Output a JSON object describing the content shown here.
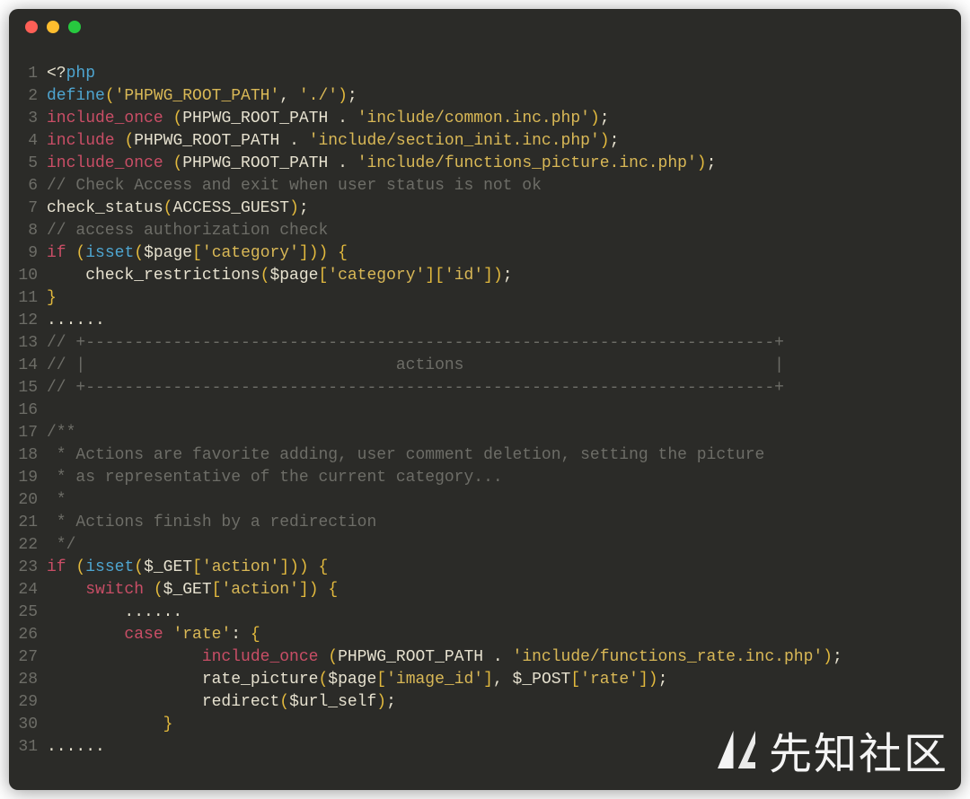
{
  "window": {
    "traffic_lights": [
      "close",
      "minimize",
      "zoom"
    ]
  },
  "watermark": {
    "text": "先知社区",
    "logo_name": "xianzhi-logo"
  },
  "code": {
    "language": "php",
    "lines": [
      {
        "n": 1,
        "tokens": [
          [
            "c-default",
            "<?"
          ],
          [
            "c-blue",
            "php"
          ]
        ]
      },
      {
        "n": 2,
        "tokens": [
          [
            "c-blue",
            "define"
          ],
          [
            "c-paren",
            "("
          ],
          [
            "c-string",
            "'PHPWG_ROOT_PATH'"
          ],
          [
            "c-default",
            ", "
          ],
          [
            "c-string",
            "'./'"
          ],
          [
            "c-paren",
            ")"
          ],
          [
            "c-default",
            ";"
          ]
        ]
      },
      {
        "n": 3,
        "tokens": [
          [
            "c-keyword",
            "include_once"
          ],
          [
            "c-default",
            " "
          ],
          [
            "c-paren",
            "("
          ],
          [
            "c-default",
            "PHPWG_ROOT_PATH . "
          ],
          [
            "c-string",
            "'include/common.inc.php'"
          ],
          [
            "c-paren",
            ")"
          ],
          [
            "c-default",
            ";"
          ]
        ]
      },
      {
        "n": 4,
        "tokens": [
          [
            "c-keyword",
            "include"
          ],
          [
            "c-default",
            " "
          ],
          [
            "c-paren",
            "("
          ],
          [
            "c-default",
            "PHPWG_ROOT_PATH . "
          ],
          [
            "c-string",
            "'include/section_init.inc.php'"
          ],
          [
            "c-paren",
            ")"
          ],
          [
            "c-default",
            ";"
          ]
        ]
      },
      {
        "n": 5,
        "tokens": [
          [
            "c-keyword",
            "include_once"
          ],
          [
            "c-default",
            " "
          ],
          [
            "c-paren",
            "("
          ],
          [
            "c-default",
            "PHPWG_ROOT_PATH . "
          ],
          [
            "c-string",
            "'include/functions_picture.inc.php'"
          ],
          [
            "c-paren",
            ")"
          ],
          [
            "c-default",
            ";"
          ]
        ]
      },
      {
        "n": 6,
        "tokens": [
          [
            "c-comment",
            "// Check Access and exit when user status is not ok"
          ]
        ]
      },
      {
        "n": 7,
        "tokens": [
          [
            "c-default",
            "check_status"
          ],
          [
            "c-paren",
            "("
          ],
          [
            "c-default",
            "ACCESS_GUEST"
          ],
          [
            "c-paren",
            ")"
          ],
          [
            "c-default",
            ";"
          ]
        ]
      },
      {
        "n": 8,
        "tokens": [
          [
            "c-comment",
            "// access authorization check"
          ]
        ]
      },
      {
        "n": 9,
        "tokens": [
          [
            "c-keyword",
            "if"
          ],
          [
            "c-default",
            " "
          ],
          [
            "c-paren",
            "("
          ],
          [
            "c-blue",
            "isset"
          ],
          [
            "c-paren",
            "("
          ],
          [
            "c-default",
            "$page"
          ],
          [
            "c-paren",
            "["
          ],
          [
            "c-string",
            "'category'"
          ],
          [
            "c-paren",
            "]))"
          ],
          [
            "c-default",
            " "
          ],
          [
            "c-brace",
            "{"
          ]
        ]
      },
      {
        "n": 10,
        "tokens": [
          [
            "c-default",
            "    check_restrictions"
          ],
          [
            "c-paren",
            "("
          ],
          [
            "c-default",
            "$page"
          ],
          [
            "c-paren",
            "["
          ],
          [
            "c-string",
            "'category'"
          ],
          [
            "c-paren",
            "]["
          ],
          [
            "c-string",
            "'id'"
          ],
          [
            "c-paren",
            "])"
          ],
          [
            "c-default",
            ";"
          ]
        ]
      },
      {
        "n": 11,
        "tokens": [
          [
            "c-brace",
            "}"
          ]
        ]
      },
      {
        "n": 12,
        "tokens": [
          [
            "c-default",
            "......"
          ]
        ]
      },
      {
        "n": 13,
        "tokens": [
          [
            "c-comment",
            "// +-----------------------------------------------------------------------+"
          ]
        ]
      },
      {
        "n": 14,
        "tokens": [
          [
            "c-comment",
            "// |                                actions                                |"
          ]
        ]
      },
      {
        "n": 15,
        "tokens": [
          [
            "c-comment",
            "// +-----------------------------------------------------------------------+"
          ]
        ]
      },
      {
        "n": 16,
        "tokens": [
          [
            "c-default",
            ""
          ]
        ]
      },
      {
        "n": 17,
        "tokens": [
          [
            "c-comment",
            "/**"
          ]
        ]
      },
      {
        "n": 18,
        "tokens": [
          [
            "c-comment",
            " * Actions are favorite adding, user comment deletion, setting the picture"
          ]
        ]
      },
      {
        "n": 19,
        "tokens": [
          [
            "c-comment",
            " * as representative of the current category..."
          ]
        ]
      },
      {
        "n": 20,
        "tokens": [
          [
            "c-comment",
            " *"
          ]
        ]
      },
      {
        "n": 21,
        "tokens": [
          [
            "c-comment",
            " * Actions finish by a redirection"
          ]
        ]
      },
      {
        "n": 22,
        "tokens": [
          [
            "c-comment",
            " */"
          ]
        ]
      },
      {
        "n": 23,
        "tokens": [
          [
            "c-keyword",
            "if"
          ],
          [
            "c-default",
            " "
          ],
          [
            "c-paren",
            "("
          ],
          [
            "c-blue",
            "isset"
          ],
          [
            "c-paren",
            "("
          ],
          [
            "c-default",
            "$_GET"
          ],
          [
            "c-paren",
            "["
          ],
          [
            "c-string",
            "'action'"
          ],
          [
            "c-paren",
            "]))"
          ],
          [
            "c-default",
            " "
          ],
          [
            "c-brace",
            "{"
          ]
        ]
      },
      {
        "n": 24,
        "tokens": [
          [
            "c-default",
            "    "
          ],
          [
            "c-keyword",
            "switch"
          ],
          [
            "c-default",
            " "
          ],
          [
            "c-paren",
            "("
          ],
          [
            "c-default",
            "$_GET"
          ],
          [
            "c-paren",
            "["
          ],
          [
            "c-string",
            "'action'"
          ],
          [
            "c-paren",
            "])"
          ],
          [
            "c-default",
            " "
          ],
          [
            "c-brace",
            "{"
          ]
        ]
      },
      {
        "n": 25,
        "tokens": [
          [
            "c-default",
            "        ......"
          ]
        ]
      },
      {
        "n": 26,
        "tokens": [
          [
            "c-default",
            "        "
          ],
          [
            "c-keyword",
            "case"
          ],
          [
            "c-default",
            " "
          ],
          [
            "c-string",
            "'rate'"
          ],
          [
            "c-default",
            ": "
          ],
          [
            "c-brace",
            "{"
          ]
        ]
      },
      {
        "n": 27,
        "tokens": [
          [
            "c-default",
            "                "
          ],
          [
            "c-keyword",
            "include_once"
          ],
          [
            "c-default",
            " "
          ],
          [
            "c-paren",
            "("
          ],
          [
            "c-default",
            "PHPWG_ROOT_PATH . "
          ],
          [
            "c-string",
            "'include/functions_rate.inc.php'"
          ],
          [
            "c-paren",
            ")"
          ],
          [
            "c-default",
            ";"
          ]
        ]
      },
      {
        "n": 28,
        "tokens": [
          [
            "c-default",
            "                rate_picture"
          ],
          [
            "c-paren",
            "("
          ],
          [
            "c-default",
            "$page"
          ],
          [
            "c-paren",
            "["
          ],
          [
            "c-string",
            "'image_id'"
          ],
          [
            "c-paren",
            "]"
          ],
          [
            "c-default",
            ", $_POST"
          ],
          [
            "c-paren",
            "["
          ],
          [
            "c-string",
            "'rate'"
          ],
          [
            "c-paren",
            "])"
          ],
          [
            "c-default",
            ";"
          ]
        ]
      },
      {
        "n": 29,
        "tokens": [
          [
            "c-default",
            "                redirect"
          ],
          [
            "c-paren",
            "("
          ],
          [
            "c-default",
            "$url_self"
          ],
          [
            "c-paren",
            ")"
          ],
          [
            "c-default",
            ";"
          ]
        ]
      },
      {
        "n": 30,
        "tokens": [
          [
            "c-default",
            "            "
          ],
          [
            "c-brace",
            "}"
          ]
        ]
      },
      {
        "n": 31,
        "tokens": [
          [
            "c-default",
            "......"
          ]
        ]
      }
    ]
  }
}
